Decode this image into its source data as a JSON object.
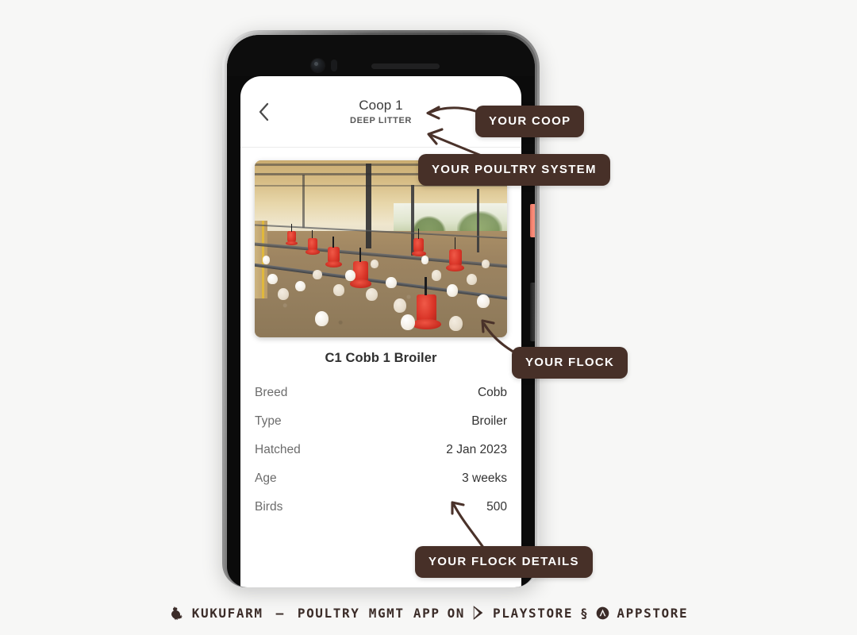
{
  "background_color": "#f7f7f6",
  "accent_color": "#473028",
  "phone": {
    "hardware": {
      "camera_icon": "camera-lens-icon",
      "sensor_icon": "proximity-sensor-icon",
      "speaker_icon": "earpiece-speaker-icon",
      "power_button": "power-button",
      "power_button_color": "#f0826f",
      "volume_button": "volume-button"
    }
  },
  "app": {
    "header": {
      "back_icon": "chevron-left-icon",
      "title": "Coop 1",
      "subtitle": "DEEP LITTER"
    },
    "hero": {
      "alt": "poultry-house-interior-photo"
    },
    "flock_title": "C1 Cobb 1 Broiler",
    "details": [
      {
        "label": "Breed",
        "value": "Cobb"
      },
      {
        "label": "Type",
        "value": "Broiler"
      },
      {
        "label": "Hatched",
        "value": "2 Jan 2023"
      },
      {
        "label": "Age",
        "value": "3 weeks"
      },
      {
        "label": "Birds",
        "value": "500"
      }
    ]
  },
  "callouts": [
    {
      "id": "your-coop",
      "text": "YOUR COOP"
    },
    {
      "id": "your-poultry-system",
      "text": "YOUR POULTRY SYSTEM"
    },
    {
      "id": "your-flock",
      "text": "YOUR FLOCK"
    },
    {
      "id": "your-flock-details",
      "text": "YOUR FLOCK DETAILS"
    }
  ],
  "footer": {
    "brand_icon": "rooster-icon",
    "brand": "KUKUFARM",
    "dash": "—",
    "tagline": "POULTRY MGMT APP",
    "on": "ON",
    "playstore_icon": "google-play-icon",
    "playstore": "PLAYSTORE",
    "ampersand": "§",
    "appstore_icon": "app-store-icon",
    "appstore": "APPSTORE"
  }
}
